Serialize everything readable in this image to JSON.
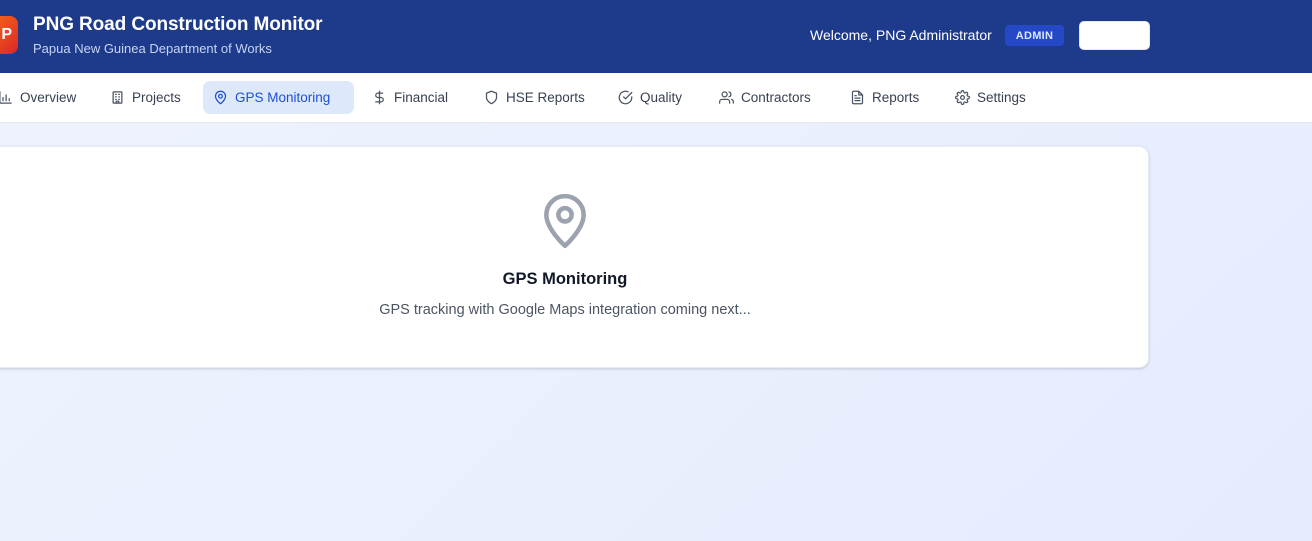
{
  "header": {
    "logo_text": "P",
    "title": "PNG Road Construction Monitor",
    "subtitle": "Papua New Guinea Department of Works",
    "welcome": "Welcome, PNG Administrator",
    "role_badge": "ADMIN"
  },
  "nav": {
    "tabs": [
      {
        "label": "Overview",
        "icon": "bar-chart-icon"
      },
      {
        "label": "Projects",
        "icon": "building-icon"
      },
      {
        "label": "GPS Monitoring",
        "icon": "map-pin-icon",
        "active": true
      },
      {
        "label": "Financial",
        "icon": "dollar-icon"
      },
      {
        "label": "HSE Reports",
        "icon": "shield-icon"
      },
      {
        "label": "Quality",
        "icon": "check-circle-icon"
      },
      {
        "label": "Contractors",
        "icon": "users-icon"
      },
      {
        "label": "Reports",
        "icon": "file-text-icon"
      },
      {
        "label": "Settings",
        "icon": "gear-icon"
      }
    ]
  },
  "main": {
    "icon": "map-pin-icon",
    "title": "GPS Monitoring",
    "message": "GPS tracking with Google Maps integration coming next..."
  },
  "colors": {
    "header_bg": "#1e3a8a",
    "accent": "#1d4ed8",
    "active_tab_bg": "#dde9fb",
    "badge_bg": "#2548c7"
  }
}
